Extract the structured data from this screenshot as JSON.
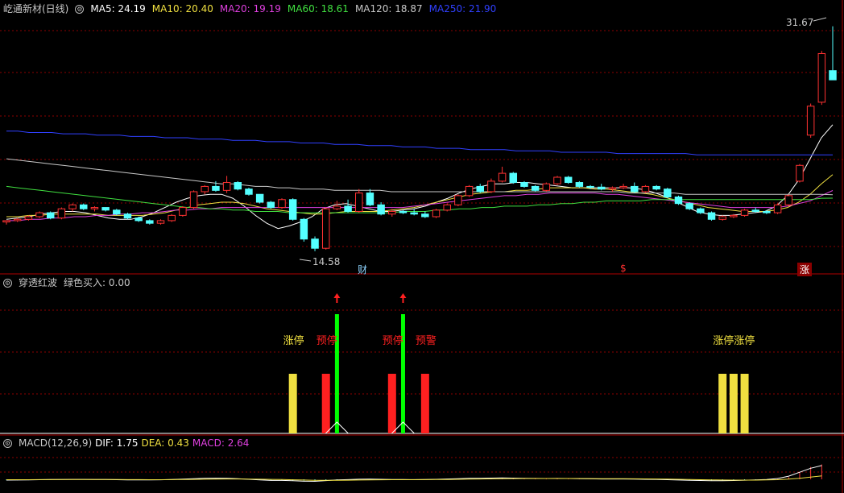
{
  "main_panel": {
    "stock_name": "屹通新材(日线)",
    "indicators": [
      {
        "label": "MA5: 24.19",
        "color": "#ffffff"
      },
      {
        "label": "MA10: 20.40",
        "color": "#f0e040"
      },
      {
        "label": "MA20: 19.19",
        "color": "#e040e0"
      },
      {
        "label": "MA60: 18.61",
        "color": "#40e040"
      },
      {
        "label": "MA120: 18.87",
        "color": "#c8c8c8"
      },
      {
        "label": "MA250: 21.90",
        "color": "#3040ff"
      }
    ],
    "high_label": "31.67",
    "low_label": "14.58",
    "markers": [
      {
        "text": "财",
        "color": "#8fd4ff"
      },
      {
        "text": "$",
        "color": "#ff3030"
      },
      {
        "text": "涨",
        "color": "#ffffff"
      }
    ]
  },
  "signal_panel": {
    "title": "穿透红波",
    "buy_label": "绿色买入: 0.00",
    "labels": [
      {
        "text": "涨停",
        "color": "#f0e040"
      },
      {
        "text": "预停",
        "color": "#ff2020"
      },
      {
        "text": "预停",
        "color": "#ff2020"
      },
      {
        "text": "预警",
        "color": "#ff2020"
      },
      {
        "text": "涨停涨停",
        "color": "#f0e040"
      }
    ]
  },
  "macd_panel": {
    "title": "MACD(12,26,9)",
    "dif": "DIF: 1.75",
    "dea": "DEA: 0.43",
    "macd": "MACD: 2.64"
  },
  "colors": {
    "up": "#ff3232",
    "down": "#54ffff",
    "grid": "#8b0000"
  },
  "chart_data": {
    "type": "candlestick",
    "price_range": [
      14.58,
      31.67
    ],
    "candles": [
      [
        16.8,
        16.9,
        16.6,
        16.9
      ],
      [
        16.9,
        17.1,
        16.8,
        17.0
      ],
      [
        17.0,
        17.3,
        16.9,
        17.2
      ],
      [
        17.2,
        17.6,
        17.1,
        17.5
      ],
      [
        17.5,
        17.6,
        17.0,
        17.1
      ],
      [
        17.1,
        17.9,
        17.0,
        17.8
      ],
      [
        17.8,
        18.2,
        17.6,
        18.1
      ],
      [
        18.1,
        18.2,
        17.7,
        17.8
      ],
      [
        17.8,
        18.0,
        17.6,
        17.9
      ],
      [
        17.9,
        17.9,
        17.6,
        17.7
      ],
      [
        17.7,
        17.8,
        17.3,
        17.4
      ],
      [
        17.4,
        17.5,
        17.0,
        17.1
      ],
      [
        17.1,
        17.2,
        16.8,
        16.9
      ],
      [
        16.9,
        17.0,
        16.6,
        16.7
      ],
      [
        16.7,
        17.0,
        16.6,
        16.9
      ],
      [
        16.9,
        17.4,
        16.8,
        17.3
      ],
      [
        17.3,
        18.0,
        17.2,
        17.9
      ],
      [
        17.9,
        19.2,
        17.8,
        19.1
      ],
      [
        19.1,
        19.6,
        18.9,
        19.5
      ],
      [
        19.5,
        19.9,
        19.1,
        19.2
      ],
      [
        19.2,
        20.3,
        19.0,
        19.8
      ],
      [
        19.8,
        19.9,
        19.2,
        19.3
      ],
      [
        19.3,
        19.4,
        18.8,
        18.9
      ],
      [
        18.9,
        18.9,
        18.2,
        18.3
      ],
      [
        18.3,
        18.4,
        17.8,
        17.9
      ],
      [
        17.9,
        18.6,
        17.8,
        18.5
      ],
      [
        18.5,
        18.6,
        16.9,
        17.0
      ],
      [
        17.0,
        17.1,
        15.3,
        15.5
      ],
      [
        15.5,
        15.7,
        14.58,
        14.8
      ],
      [
        14.8,
        17.9,
        14.7,
        17.8
      ],
      [
        17.8,
        18.4,
        17.7,
        18.0
      ],
      [
        18.0,
        18.5,
        17.5,
        17.6
      ],
      [
        17.6,
        19.3,
        17.5,
        19.0
      ],
      [
        19.0,
        19.3,
        18.0,
        18.1
      ],
      [
        18.1,
        18.3,
        17.3,
        17.4
      ],
      [
        17.4,
        17.8,
        17.2,
        17.6
      ],
      [
        17.6,
        17.7,
        17.4,
        17.5
      ],
      [
        17.5,
        17.8,
        17.3,
        17.4
      ],
      [
        17.4,
        17.6,
        17.1,
        17.2
      ],
      [
        17.2,
        17.8,
        17.1,
        17.7
      ],
      [
        17.7,
        18.2,
        17.6,
        18.1
      ],
      [
        18.1,
        18.9,
        18.0,
        18.8
      ],
      [
        18.8,
        19.6,
        18.7,
        19.5
      ],
      [
        19.5,
        19.7,
        19.0,
        19.1
      ],
      [
        19.1,
        20.1,
        19.0,
        19.9
      ],
      [
        19.9,
        21.0,
        19.8,
        20.5
      ],
      [
        20.5,
        20.6,
        19.7,
        19.8
      ],
      [
        19.8,
        19.9,
        19.4,
        19.5
      ],
      [
        19.5,
        19.6,
        19.1,
        19.2
      ],
      [
        19.2,
        19.8,
        19.1,
        19.7
      ],
      [
        19.7,
        20.3,
        19.6,
        20.2
      ],
      [
        20.2,
        20.3,
        19.7,
        19.8
      ],
      [
        19.8,
        19.9,
        19.4,
        19.5
      ],
      [
        19.5,
        19.6,
        19.3,
        19.45
      ],
      [
        19.45,
        19.7,
        19.2,
        19.3
      ],
      [
        19.3,
        19.5,
        19.1,
        19.4
      ],
      [
        19.4,
        19.7,
        19.3,
        19.5
      ],
      [
        19.5,
        19.8,
        19.0,
        19.1
      ],
      [
        19.1,
        19.6,
        19.0,
        19.5
      ],
      [
        19.5,
        19.6,
        19.2,
        19.3
      ],
      [
        19.3,
        19.4,
        18.6,
        18.7
      ],
      [
        18.7,
        18.8,
        18.1,
        18.2
      ],
      [
        18.2,
        18.3,
        17.7,
        17.8
      ],
      [
        17.8,
        17.9,
        17.4,
        17.5
      ],
      [
        17.5,
        17.6,
        16.9,
        17.0
      ],
      [
        17.0,
        17.3,
        16.9,
        17.2
      ],
      [
        17.2,
        17.4,
        17.1,
        17.3
      ],
      [
        17.3,
        17.8,
        17.2,
        17.7
      ],
      [
        17.7,
        17.9,
        17.5,
        17.6
      ],
      [
        17.6,
        17.7,
        17.4,
        17.5
      ],
      [
        17.5,
        18.2,
        17.4,
        18.1
      ],
      [
        18.1,
        18.9,
        18.0,
        18.8
      ],
      [
        19.9,
        21.2,
        19.8,
        21.1
      ],
      [
        23.4,
        25.8,
        23.2,
        25.6
      ],
      [
        25.9,
        29.8,
        25.7,
        29.6
      ],
      [
        28.3,
        31.67,
        27.7,
        27.6
      ]
    ],
    "ma_series": [
      {
        "name": "MA5",
        "color": "#ffffff",
        "values": [
          17.0,
          17.1,
          17.2,
          17.4,
          17.5,
          17.6,
          17.6,
          17.5,
          17.3,
          17.1,
          17.0,
          17.0,
          17.2,
          17.5,
          17.9,
          18.3,
          18.6,
          18.8,
          18.9,
          18.9,
          18.6,
          18.0,
          17.3,
          16.7,
          16.3,
          16.5,
          16.8,
          17.2,
          17.8,
          18.1,
          18.2,
          18.0,
          17.8,
          17.6,
          17.6,
          17.7,
          17.8,
          18.0,
          18.3,
          18.6,
          19.0,
          19.3,
          19.5,
          19.7,
          19.7,
          19.8,
          19.8,
          19.7,
          19.6,
          19.5,
          19.4,
          19.4,
          19.4,
          19.4,
          19.4,
          19.4,
          19.3,
          19.1,
          18.8,
          18.4,
          18.0,
          17.6,
          17.4,
          17.3,
          17.3,
          17.4,
          17.5,
          17.6,
          18.0,
          18.8,
          20.0,
          21.6,
          23.2,
          24.19
        ]
      },
      {
        "name": "MA10",
        "color": "#f0e040",
        "values": [
          17.2,
          17.2,
          17.3,
          17.3,
          17.4,
          17.4,
          17.4,
          17.4,
          17.4,
          17.3,
          17.3,
          17.3,
          17.3,
          17.4,
          17.5,
          17.7,
          17.9,
          18.1,
          18.2,
          18.3,
          18.3,
          18.2,
          18.0,
          17.8,
          17.7,
          17.6,
          17.5,
          17.4,
          17.4,
          17.5,
          17.6,
          17.6,
          17.6,
          17.6,
          17.7,
          17.8,
          17.9,
          18.1,
          18.3,
          18.5,
          18.7,
          18.9,
          19.0,
          19.1,
          19.1,
          19.2,
          19.2,
          19.3,
          19.4,
          19.4,
          19.4,
          19.4,
          19.3,
          19.3,
          19.2,
          19.1,
          19.0,
          18.9,
          18.7,
          18.5,
          18.3,
          18.1,
          17.9,
          17.8,
          17.7,
          17.6,
          17.6,
          17.6,
          17.7,
          17.9,
          18.3,
          18.9,
          19.7,
          20.4
        ]
      },
      {
        "name": "MA20",
        "color": "#e040e0",
        "values": [
          16.9,
          16.9,
          17.0,
          17.0,
          17.1,
          17.1,
          17.2,
          17.2,
          17.3,
          17.3,
          17.4,
          17.4,
          17.5,
          17.5,
          17.6,
          17.7,
          17.7,
          17.8,
          17.8,
          17.9,
          17.9,
          17.9,
          17.9,
          17.9,
          17.9,
          17.9,
          17.9,
          17.9,
          17.9,
          17.9,
          17.9,
          17.9,
          17.9,
          17.9,
          17.9,
          17.9,
          18.0,
          18.1,
          18.2,
          18.3,
          18.4,
          18.5,
          18.6,
          18.7,
          18.8,
          18.8,
          18.9,
          18.9,
          19.0,
          19.0,
          19.0,
          19.0,
          19.0,
          18.9,
          18.9,
          18.8,
          18.7,
          18.6,
          18.5,
          18.4,
          18.3,
          18.2,
          18.1,
          18.0,
          17.9,
          17.9,
          17.9,
          17.9,
          17.9,
          18.0,
          18.2,
          18.4,
          18.8,
          19.19
        ]
      },
      {
        "name": "MA60",
        "color": "#40e040",
        "values": [
          19.5,
          19.4,
          19.3,
          19.2,
          19.1,
          19.0,
          18.9,
          18.8,
          18.7,
          18.6,
          18.5,
          18.4,
          18.3,
          18.2,
          18.1,
          18.0,
          17.9,
          17.9,
          17.8,
          17.8,
          17.7,
          17.7,
          17.6,
          17.6,
          17.6,
          17.5,
          17.5,
          17.5,
          17.5,
          17.5,
          17.5,
          17.5,
          17.5,
          17.5,
          17.5,
          17.6,
          17.6,
          17.6,
          17.7,
          17.7,
          17.8,
          17.8,
          17.9,
          17.9,
          18.0,
          18.0,
          18.0,
          18.1,
          18.1,
          18.2,
          18.2,
          18.3,
          18.3,
          18.4,
          18.4,
          18.4,
          18.4,
          18.5,
          18.5,
          18.5,
          18.5,
          18.5,
          18.5,
          18.5,
          18.5,
          18.5,
          18.5,
          18.5,
          18.5,
          18.5,
          18.5,
          18.5,
          18.6,
          18.61
        ]
      },
      {
        "name": "MA120",
        "color": "#c8c8c8",
        "values": [
          21.6,
          21.5,
          21.4,
          21.3,
          21.2,
          21.1,
          21.0,
          20.9,
          20.8,
          20.7,
          20.6,
          20.5,
          20.4,
          20.3,
          20.2,
          20.1,
          20.0,
          19.9,
          19.8,
          19.7,
          19.7,
          19.6,
          19.5,
          19.5,
          19.4,
          19.4,
          19.3,
          19.3,
          19.3,
          19.2,
          19.2,
          19.2,
          19.2,
          19.2,
          19.1,
          19.1,
          19.1,
          19.1,
          19.1,
          19.1,
          19.1,
          19.1,
          19.1,
          19.1,
          19.1,
          19.1,
          19.1,
          19.1,
          19.1,
          19.1,
          19.1,
          19.1,
          19.1,
          19.1,
          19.1,
          19.0,
          19.0,
          19.0,
          19.0,
          19.0,
          18.9,
          18.9,
          18.9,
          18.9,
          18.9,
          18.9,
          18.9,
          18.9,
          18.9,
          18.9,
          18.9,
          18.9,
          18.9,
          18.87
        ]
      },
      {
        "name": "MA250",
        "color": "#3040ff",
        "values": [
          23.7,
          23.7,
          23.6,
          23.6,
          23.6,
          23.5,
          23.5,
          23.5,
          23.4,
          23.4,
          23.4,
          23.3,
          23.3,
          23.3,
          23.2,
          23.2,
          23.2,
          23.1,
          23.1,
          23.1,
          23.0,
          23.0,
          23.0,
          22.9,
          22.9,
          22.9,
          22.8,
          22.8,
          22.8,
          22.7,
          22.7,
          22.7,
          22.6,
          22.6,
          22.6,
          22.5,
          22.5,
          22.5,
          22.4,
          22.4,
          22.4,
          22.3,
          22.3,
          22.3,
          22.3,
          22.2,
          22.2,
          22.2,
          22.2,
          22.1,
          22.1,
          22.1,
          22.1,
          22.1,
          22.0,
          22.0,
          22.0,
          22.0,
          22.0,
          22.0,
          22.0,
          21.9,
          21.9,
          21.9,
          21.9,
          21.9,
          21.9,
          21.9,
          21.9,
          21.9,
          21.9,
          21.9,
          21.9,
          21.9
        ]
      }
    ],
    "signals": [
      {
        "index": 26,
        "value": 1,
        "color": "#f0e040",
        "label": 0
      },
      {
        "index": 29,
        "value": 1,
        "color": "#ff2020",
        "label": 1
      },
      {
        "index": 30,
        "value": 2,
        "color": "#00ff00",
        "arrow": true
      },
      {
        "index": 35,
        "value": 1,
        "color": "#ff2020",
        "label": 2
      },
      {
        "index": 36,
        "value": 2,
        "color": "#00ff00",
        "arrow": true
      },
      {
        "index": 38,
        "value": 1,
        "color": "#ff2020",
        "label": 3
      },
      {
        "index": 65,
        "value": 1,
        "color": "#f0e040",
        "label": 4
      },
      {
        "index": 66,
        "value": 1,
        "color": "#f0e040"
      },
      {
        "index": 67,
        "value": 1,
        "color": "#f0e040"
      }
    ],
    "macd": [
      -0.18,
      -0.17,
      -0.15,
      -0.12,
      -0.1,
      -0.07,
      -0.05,
      -0.04,
      -0.05,
      -0.06,
      -0.08,
      -0.1,
      -0.12,
      -0.12,
      -0.1,
      -0.06,
      0.0,
      0.06,
      0.1,
      0.12,
      0.1,
      0.05,
      -0.02,
      -0.1,
      -0.16,
      -0.16,
      -0.2,
      -0.26,
      -0.28,
      -0.18,
      -0.1,
      -0.06,
      0.0,
      0.02,
      -0.02,
      -0.04,
      -0.05,
      -0.06,
      -0.05,
      -0.02,
      0.02,
      0.06,
      0.1,
      0.1,
      0.12,
      0.14,
      0.12,
      0.1,
      0.08,
      0.08,
      0.09,
      0.08,
      0.06,
      0.04,
      0.02,
      0.02,
      0.02,
      0.0,
      -0.02,
      -0.02,
      -0.06,
      -0.1,
      -0.14,
      -0.16,
      -0.18,
      -0.18,
      -0.16,
      -0.12,
      -0.08,
      -0.04,
      0.05,
      0.4,
      1.3,
      2.2,
      2.64
    ],
    "macd_dif": [
      -0.1,
      -0.09,
      -0.07,
      -0.05,
      -0.03,
      -0.02,
      -0.01,
      -0.01,
      -0.02,
      -0.03,
      -0.05,
      -0.07,
      -0.08,
      -0.08,
      -0.06,
      -0.02,
      0.03,
      0.08,
      0.12,
      0.14,
      0.12,
      0.07,
      0.0,
      -0.08,
      -0.14,
      -0.14,
      -0.18,
      -0.24,
      -0.26,
      -0.16,
      -0.08,
      -0.04,
      0.01,
      0.03,
      0.0,
      -0.02,
      -0.03,
      -0.04,
      -0.03,
      0.0,
      0.04,
      0.08,
      0.12,
      0.13,
      0.15,
      0.17,
      0.15,
      0.13,
      0.11,
      0.1,
      0.11,
      0.1,
      0.08,
      0.06,
      0.04,
      0.04,
      0.04,
      0.02,
      0.0,
      -0.01,
      -0.05,
      -0.09,
      -0.13,
      -0.15,
      -0.17,
      -0.17,
      -0.15,
      -0.11,
      -0.07,
      -0.02,
      0.1,
      0.4,
      0.9,
      1.4,
      1.75
    ],
    "macd_dea": [
      -0.05,
      -0.05,
      -0.05,
      -0.04,
      -0.04,
      -0.03,
      -0.03,
      -0.03,
      -0.03,
      -0.03,
      -0.03,
      -0.04,
      -0.04,
      -0.05,
      -0.05,
      -0.04,
      -0.03,
      -0.01,
      0.01,
      0.03,
      0.04,
      0.04,
      0.03,
      0.01,
      -0.01,
      -0.03,
      -0.06,
      -0.09,
      -0.12,
      -0.13,
      -0.12,
      -0.11,
      -0.09,
      -0.07,
      -0.06,
      -0.05,
      -0.05,
      -0.05,
      -0.04,
      -0.03,
      -0.02,
      0.0,
      0.02,
      0.04,
      0.06,
      0.08,
      0.09,
      0.1,
      0.1,
      0.1,
      0.1,
      0.1,
      0.1,
      0.09,
      0.08,
      0.07,
      0.07,
      0.06,
      0.05,
      0.04,
      0.02,
      0.0,
      -0.03,
      -0.05,
      -0.07,
      -0.09,
      -0.1,
      -0.1,
      -0.1,
      -0.08,
      -0.05,
      0.02,
      0.12,
      0.28,
      0.43
    ]
  }
}
